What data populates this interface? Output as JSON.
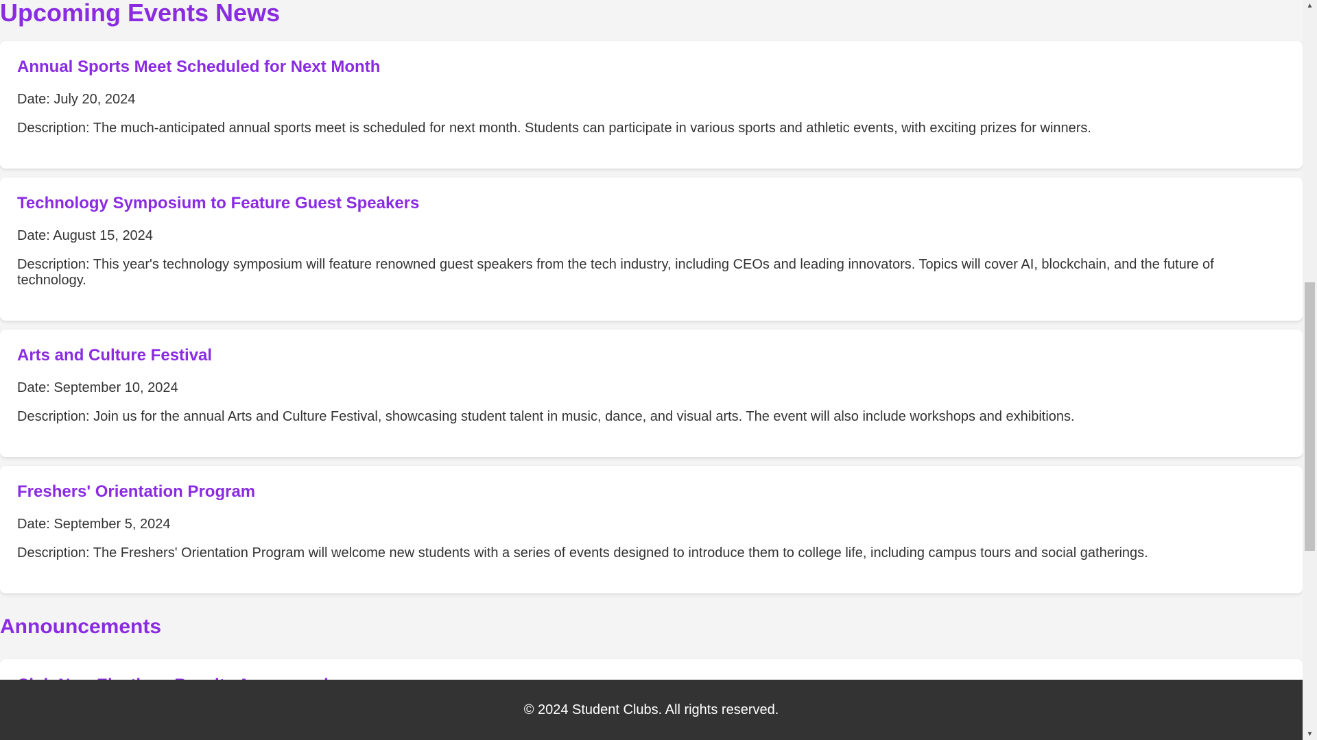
{
  "events": {
    "heading": "Upcoming Events News",
    "items": [
      {
        "title": "Annual Sports Meet Scheduled for Next Month",
        "date": "Date: July 20, 2024",
        "description": "Description: The much-anticipated annual sports meet is scheduled for next month. Students can participate in various sports and athletic events, with exciting prizes for winners."
      },
      {
        "title": "Technology Symposium to Feature Guest Speakers",
        "date": "Date: August 15, 2024",
        "description": "Description: This year's technology symposium will feature renowned guest speakers from the tech industry, including CEOs and leading innovators. Topics will cover AI, blockchain, and the future of technology."
      },
      {
        "title": "Arts and Culture Festival",
        "date": "Date: September 10, 2024",
        "description": "Description: Join us for the annual Arts and Culture Festival, showcasing student talent in music, dance, and visual arts. The event will also include workshops and exhibitions."
      },
      {
        "title": "Freshers' Orientation Program",
        "date": "Date: September 5, 2024",
        "description": "Description: The Freshers' Orientation Program will welcome new students with a series of events designed to introduce them to college life, including campus tours and social gatherings."
      }
    ]
  },
  "announcements": {
    "heading": "Announcements",
    "partial_item_title": "Club New Elections Results Announced"
  },
  "footer": {
    "text": "© 2024 Student Clubs. All rights reserved."
  },
  "scrollbar": {
    "up_icon": "▲",
    "down_icon": "▼"
  },
  "colors": {
    "accent": "#8a2be2",
    "text": "#333333",
    "background": "#f4f4f4",
    "card": "#ffffff",
    "footer": "#333333"
  }
}
